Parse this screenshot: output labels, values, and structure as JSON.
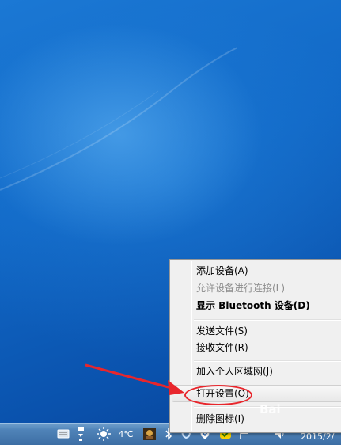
{
  "context_menu": {
    "items": [
      {
        "label": "添加设备(A)",
        "state": "normal"
      },
      {
        "label": "允许设备进行连接(L)",
        "state": "disabled"
      },
      {
        "label": "显示 Bluetooth 设备(D)",
        "state": "bold"
      },
      {
        "label": "发送文件(S)",
        "state": "normal"
      },
      {
        "label": "接收文件(R)",
        "state": "normal"
      },
      {
        "label": "加入个人区域网(J)",
        "state": "normal"
      },
      {
        "label": "打开设置(O)",
        "state": "highlighted"
      },
      {
        "label": "删除图标(I)",
        "state": "normal"
      }
    ]
  },
  "tray": {
    "temperature": "4℃",
    "clock_date": "2015/2/"
  },
  "watermark": "Bai",
  "colors": {
    "annotation": "#e8262c",
    "desktop": "#1168c6",
    "taskbar": "#4f83b8"
  },
  "icons": [
    "keyboard-icon",
    "network-icon",
    "weather-sun-icon",
    "game-icon",
    "bluetooth-icon",
    "sync-icon",
    "shield-icon",
    "security-icon",
    "flag-icon",
    "volume-icon"
  ]
}
